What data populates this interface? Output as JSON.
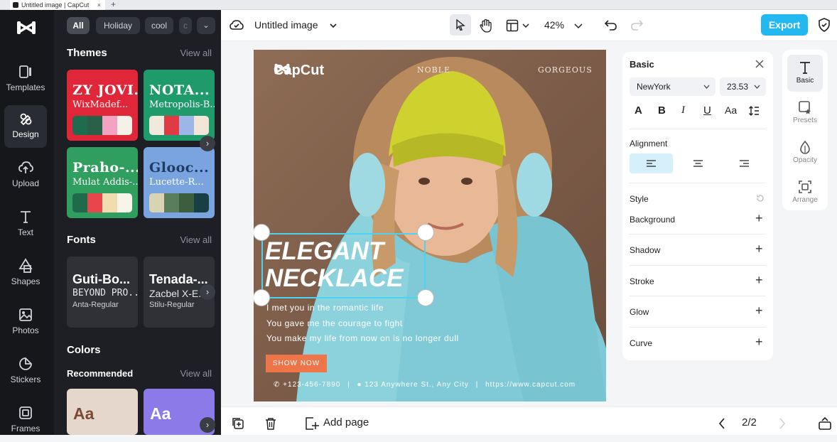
{
  "browser": {
    "tab_title": "Untitled image | CapCut",
    "close": "×",
    "new_tab": "+"
  },
  "rail": {
    "items": [
      {
        "label": "Templates"
      },
      {
        "label": "Design"
      },
      {
        "label": "Upload"
      },
      {
        "label": "Text"
      },
      {
        "label": "Shapes"
      },
      {
        "label": "Photos"
      },
      {
        "label": "Stickers"
      },
      {
        "label": "Frames"
      }
    ]
  },
  "panel": {
    "chips": [
      "All",
      "Holiday",
      "cool",
      "c"
    ],
    "themes": {
      "title": "Themes",
      "view_all": "View all",
      "cards": [
        {
          "name": "ZY JOVI...",
          "font": "WixMadef...",
          "bg": "#e0273a",
          "swatches": [
            "#1f6b4e",
            "#2a6048",
            "#f2a3c2",
            "#f5f1e6"
          ]
        },
        {
          "name": "NOTA...",
          "font": "Metropolis-B...",
          "bg": "#1f9a6b",
          "swatches": [
            "#f2e9de",
            "#e03a44",
            "#9db6e8",
            "#f2e4d6"
          ]
        },
        {
          "name": "Praho-...",
          "font": "Mulat Addis-...",
          "bg": "#2f9e5e",
          "swatches": [
            "#1e6a4a",
            "#e8454d",
            "#f0dcae",
            "#f7f5ea"
          ]
        },
        {
          "name": "Glooc...",
          "font": "Lucette-R...",
          "bg": "#7aa4df",
          "swatches": [
            "#d8d3b2",
            "#5a7d5b",
            "#3d5e3e",
            "#183f44"
          ]
        }
      ]
    },
    "fonts": {
      "title": "Fonts",
      "view_all": "View all",
      "cards": [
        {
          "a": "Guti-Bo...",
          "b": "BEYOND PRO...",
          "c": "Anta-Regular"
        },
        {
          "a": "Tenada-...",
          "b": "Zacbel X-E...",
          "c": "Stilu-Regular"
        }
      ]
    },
    "colors": {
      "title": "Colors",
      "recommended": "Recommended",
      "view_all": "View all",
      "sample": "Aa"
    },
    "arrow": "›"
  },
  "topbar": {
    "title": "Untitled image",
    "zoom": "42%",
    "export": "Export"
  },
  "canvas": {
    "brand": "CapCut",
    "noble": "NOBLE",
    "gorgeous": "GORGEOUS",
    "headline_1": "ELEGANT",
    "headline_2": "NECKLACE",
    "lines": [
      "I met you in the romantic life",
      "You gave me the courage to fight",
      "You make my life from now on is no longer dull"
    ],
    "cta": "SHOW NOW",
    "phone": "+123-456-7890",
    "address": "123 Anywhere St., Any City",
    "url": "https://www.capcut.com",
    "separator": "|"
  },
  "props": {
    "title": "Basic",
    "font": "NewYork",
    "size": "23.53",
    "alignment": "Alignment",
    "style": "Style",
    "rows": [
      "Background",
      "Shadow",
      "Stroke",
      "Glow",
      "Curve"
    ],
    "plus": "+"
  },
  "side": {
    "items": [
      "Basic",
      "Presets",
      "Opacity",
      "Arrange"
    ]
  },
  "bottom": {
    "add_page": "Add page",
    "pages": "2/2"
  }
}
